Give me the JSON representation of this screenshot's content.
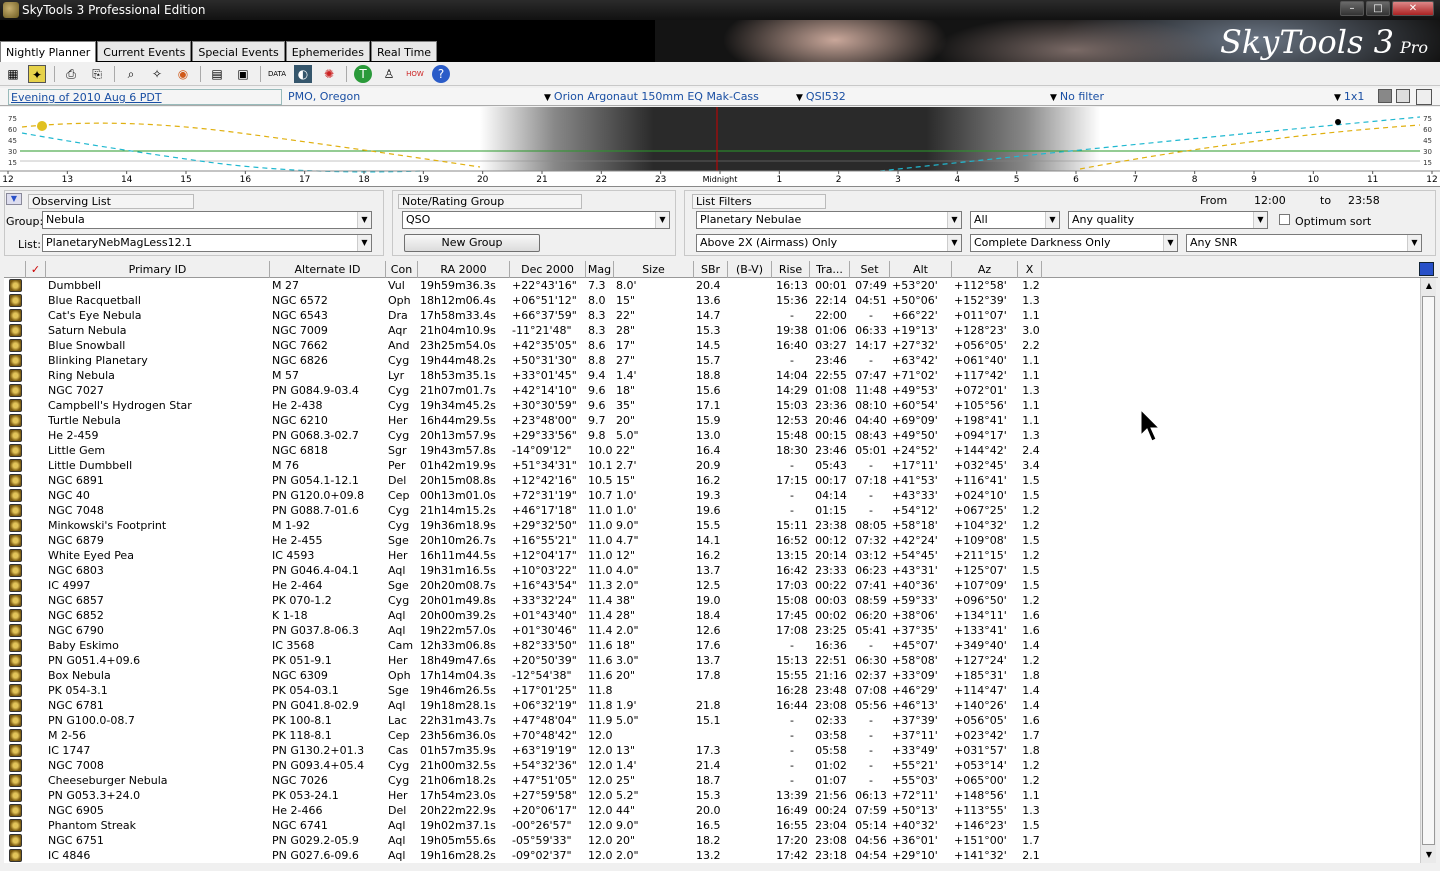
{
  "window": {
    "title": "SkyTools 3 Professional Edition",
    "minimize": "–",
    "maximize": "□",
    "close": "✕"
  },
  "banner": {
    "brand": "SkyTools 3",
    "edition": "Pro"
  },
  "tabs": [
    "Nightly Planner",
    "Current Events",
    "Special Events",
    "Ephemerides",
    "Real Time"
  ],
  "info": {
    "date": "Evening of 2010 Aug 6 PDT",
    "location": "PMO, Oregon",
    "telescope": "Orion Argonaut 150mm EQ Mak-Cass",
    "camera": "QSI532",
    "filter": "No filter",
    "layout": "1x1"
  },
  "graph": {
    "y_labels_left": [
      "75",
      "60",
      "45",
      "30",
      "15"
    ],
    "y_labels_right": [
      "75",
      "60",
      "45",
      "30",
      "15"
    ],
    "hours": [
      "12",
      "13",
      "14",
      "15",
      "16",
      "17",
      "18",
      "19",
      "20",
      "21",
      "22",
      "23",
      "Midnight",
      "1",
      "2",
      "3",
      "4",
      "5",
      "6",
      "7",
      "8",
      "9",
      "10",
      "11",
      "12"
    ]
  },
  "observing_list": {
    "title": "Observing List",
    "group_label": "Group:",
    "group_value": "Nebula",
    "list_label": "List:",
    "list_value": "PlanetaryNebMagLess12.1"
  },
  "note_group": {
    "title": "Note/Rating Group",
    "value": "QSO",
    "new_group": "New Group"
  },
  "list_filters": {
    "title": "List Filters",
    "from_label": "From",
    "from_value": "12:00",
    "to_label": "to",
    "to_value": "23:58",
    "type": "Planetary Nebulae",
    "constellation": "All",
    "quality": "Any quality",
    "optimum_sort": "Optimum sort",
    "airmass": "Above 2X (Airmass) Only",
    "darkness": "Complete Darkness Only",
    "snr": "Any SNR"
  },
  "columns": [
    "✓",
    "Primary ID",
    "Alternate ID",
    "Con",
    "RA 2000",
    "Dec 2000",
    "Mag",
    "Size",
    "SBr",
    "(B-V)",
    "Rise",
    "Tra...",
    "Set",
    "Alt",
    "Az",
    "X"
  ],
  "rows": [
    [
      "Dumbbell",
      "M 27",
      "Vul",
      "19h59m36.3s",
      "+22°43'16\"",
      "7.3",
      "8.0'",
      "20.4",
      "16:13",
      "00:01",
      "07:49",
      "+53°20'",
      "+112°58'",
      "1.2"
    ],
    [
      "Blue Racquetball",
      "NGC 6572",
      "Oph",
      "18h12m06.4s",
      "+06°51'12\"",
      "8.0",
      "15\"",
      "13.6",
      "15:36",
      "22:14",
      "04:51",
      "+50°06'",
      "+152°39'",
      "1.3"
    ],
    [
      "Cat's Eye Nebula",
      "NGC 6543",
      "Dra",
      "17h58m33.4s",
      "+66°37'59\"",
      "8.3",
      "22\"",
      "14.7",
      "-",
      "22:00",
      "-",
      "+66°22'",
      "+011°07'",
      "1.1"
    ],
    [
      "Saturn Nebula",
      "NGC 7009",
      "Aqr",
      "21h04m10.9s",
      "-11°21'48\"",
      "8.3",
      "28\"",
      "15.3",
      "19:38",
      "01:06",
      "06:33",
      "+19°13'",
      "+128°23'",
      "3.0"
    ],
    [
      "Blue Snowball",
      "NGC 7662",
      "And",
      "23h25m54.0s",
      "+42°35'05\"",
      "8.6",
      "17\"",
      "14.5",
      "16:40",
      "03:27",
      "14:17",
      "+27°32'",
      "+056°05'",
      "2.2"
    ],
    [
      "Blinking Planetary",
      "NGC 6826",
      "Cyg",
      "19h44m48.2s",
      "+50°31'30\"",
      "8.8",
      "27\"",
      "15.7",
      "-",
      "23:46",
      "-",
      "+63°42'",
      "+061°40'",
      "1.1"
    ],
    [
      "Ring Nebula",
      "M 57",
      "Lyr",
      "18h53m35.1s",
      "+33°01'45\"",
      "9.4",
      "1.4'",
      "18.8",
      "14:04",
      "22:55",
      "07:47",
      "+71°02'",
      "+117°42'",
      "1.1"
    ],
    [
      "NGC 7027",
      "PN G084.9-03.4",
      "Cyg",
      "21h07m01.7s",
      "+42°14'10\"",
      "9.6",
      "18\"",
      "15.6",
      "14:29",
      "01:08",
      "11:48",
      "+49°53'",
      "+072°01'",
      "1.3"
    ],
    [
      "Campbell's Hydrogen Star",
      "He 2-438",
      "Cyg",
      "19h34m45.2s",
      "+30°30'59\"",
      "9.6",
      "35\"",
      "17.1",
      "15:03",
      "23:36",
      "08:10",
      "+60°54'",
      "+105°56'",
      "1.1"
    ],
    [
      "Turtle Nebula",
      "NGC 6210",
      "Her",
      "16h44m29.5s",
      "+23°48'00\"",
      "9.7",
      "20\"",
      "15.9",
      "12:53",
      "20:46",
      "04:40",
      "+69°09'",
      "+198°41'",
      "1.1"
    ],
    [
      "He 2-459",
      "PN G068.3-02.7",
      "Cyg",
      "20h13m57.9s",
      "+29°33'56\"",
      "9.8",
      "5.0\"",
      "13.0",
      "15:48",
      "00:15",
      "08:43",
      "+49°50'",
      "+094°17'",
      "1.3"
    ],
    [
      "Little Gem",
      "NGC 6818",
      "Sgr",
      "19h43m57.8s",
      "-14°09'12\"",
      "10.0",
      "22\"",
      "16.4",
      "18:30",
      "23:46",
      "05:01",
      "+24°52'",
      "+144°42'",
      "2.4"
    ],
    [
      "Little Dumbbell",
      "M 76",
      "Per",
      "01h42m19.9s",
      "+51°34'31\"",
      "10.1",
      "2.7'",
      "20.9",
      "-",
      "05:43",
      "-",
      "+17°11'",
      "+032°45'",
      "3.4"
    ],
    [
      "NGC 6891",
      "PN G054.1-12.1",
      "Del",
      "20h15m08.8s",
      "+12°42'16\"",
      "10.5",
      "15\"",
      "16.2",
      "17:15",
      "00:17",
      "07:18",
      "+41°53'",
      "+116°41'",
      "1.5"
    ],
    [
      "NGC 40",
      "PN G120.0+09.8",
      "Cep",
      "00h13m01.0s",
      "+72°31'19\"",
      "10.7",
      "1.0'",
      "19.3",
      "-",
      "04:14",
      "-",
      "+43°33'",
      "+024°10'",
      "1.5"
    ],
    [
      "NGC 7048",
      "PN G088.7-01.6",
      "Cyg",
      "21h14m15.2s",
      "+46°17'18\"",
      "11.0",
      "1.0'",
      "19.6",
      "-",
      "01:15",
      "-",
      "+54°12'",
      "+067°25'",
      "1.2"
    ],
    [
      "Minkowski's Footprint",
      "M 1-92",
      "Cyg",
      "19h36m18.9s",
      "+29°32'50\"",
      "11.0",
      "9.0\"",
      "15.5",
      "15:11",
      "23:38",
      "08:05",
      "+58°18'",
      "+104°32'",
      "1.2"
    ],
    [
      "NGC 6879",
      "He 2-455",
      "Sge",
      "20h10m26.7s",
      "+16°55'21\"",
      "11.0",
      "4.7\"",
      "14.1",
      "16:52",
      "00:12",
      "07:32",
      "+42°24'",
      "+109°08'",
      "1.5"
    ],
    [
      "White Eyed Pea",
      "IC 4593",
      "Her",
      "16h11m44.5s",
      "+12°04'17\"",
      "11.0",
      "12\"",
      "16.2",
      "13:15",
      "20:14",
      "03:12",
      "+54°45'",
      "+211°15'",
      "1.2"
    ],
    [
      "NGC 6803",
      "PN G046.4-04.1",
      "Aql",
      "19h31m16.5s",
      "+10°03'22\"",
      "11.0",
      "4.0\"",
      "13.7",
      "16:42",
      "23:33",
      "06:23",
      "+43°31'",
      "+125°07'",
      "1.5"
    ],
    [
      "IC 4997",
      "He 2-464",
      "Sge",
      "20h20m08.7s",
      "+16°43'54\"",
      "11.3",
      "2.0\"",
      "12.5",
      "17:03",
      "00:22",
      "07:41",
      "+40°36'",
      "+107°09'",
      "1.5"
    ],
    [
      "NGC 6857",
      "PK 070-1.2",
      "Cyg",
      "20h01m49.8s",
      "+33°32'24\"",
      "11.4",
      "38\"",
      "19.0",
      "15:08",
      "00:03",
      "08:59",
      "+59°33'",
      "+096°50'",
      "1.2"
    ],
    [
      "NGC 6852",
      "K 1-18",
      "Aql",
      "20h00m39.2s",
      "+01°43'40\"",
      "11.4",
      "28\"",
      "18.4",
      "17:45",
      "00:02",
      "06:20",
      "+38°06'",
      "+134°11'",
      "1.6"
    ],
    [
      "NGC 6790",
      "PN G037.8-06.3",
      "Aql",
      "19h22m57.0s",
      "+01°30'46\"",
      "11.4",
      "2.0\"",
      "12.6",
      "17:08",
      "23:25",
      "05:41",
      "+37°35'",
      "+133°41'",
      "1.6"
    ],
    [
      "Baby Eskimo",
      "IC 3568",
      "Cam",
      "12h33m06.8s",
      "+82°33'50\"",
      "11.6",
      "18\"",
      "17.6",
      "-",
      "16:36",
      "-",
      "+45°07'",
      "+349°40'",
      "1.4"
    ],
    [
      "PN G051.4+09.6",
      "PK 051-9.1",
      "Her",
      "18h49m47.6s",
      "+20°50'39\"",
      "11.6",
      "3.0\"",
      "13.7",
      "15:13",
      "22:51",
      "06:30",
      "+58°08'",
      "+127°24'",
      "1.2"
    ],
    [
      "Box Nebula",
      "NGC 6309",
      "Oph",
      "17h14m04.3s",
      "-12°54'38\"",
      "11.6",
      "20\"",
      "17.8",
      "15:55",
      "21:16",
      "02:37",
      "+33°09'",
      "+185°31'",
      "1.8"
    ],
    [
      "PK 054-3.1",
      "PK 054-03.1",
      "Sge",
      "19h46m26.5s",
      "+17°01'25\"",
      "11.8",
      "",
      "",
      "16:28",
      "23:48",
      "07:08",
      "+46°29'",
      "+114°47'",
      "1.4"
    ],
    [
      "NGC 6781",
      "PN G041.8-02.9",
      "Aql",
      "19h18m28.1s",
      "+06°32'19\"",
      "11.8",
      "1.9'",
      "21.8",
      "16:44",
      "23:08",
      "05:56",
      "+46°13'",
      "+140°26'",
      "1.4"
    ],
    [
      "PN G100.0-08.7",
      "PK 100-8.1",
      "Lac",
      "22h31m43.7s",
      "+47°48'04\"",
      "11.9",
      "5.0\"",
      "15.1",
      "-",
      "02:33",
      "-",
      "+37°39'",
      "+056°05'",
      "1.6"
    ],
    [
      "M 2-56",
      "PK 118-8.1",
      "Cep",
      "23h56m36.0s",
      "+70°48'42\"",
      "12.0",
      "",
      "",
      "-",
      "03:58",
      "-",
      "+37°11'",
      "+023°42'",
      "1.7"
    ],
    [
      "IC 1747",
      "PN G130.2+01.3",
      "Cas",
      "01h57m35.9s",
      "+63°19'19\"",
      "12.0",
      "13\"",
      "17.3",
      "-",
      "05:58",
      "-",
      "+33°49'",
      "+031°57'",
      "1.8"
    ],
    [
      "NGC 7008",
      "PN G093.4+05.4",
      "Cyg",
      "21h00m32.5s",
      "+54°32'36\"",
      "12.0",
      "1.4'",
      "21.4",
      "-",
      "01:02",
      "-",
      "+55°21'",
      "+053°14'",
      "1.2"
    ],
    [
      "Cheeseburger Nebula",
      "NGC 7026",
      "Cyg",
      "21h06m18.2s",
      "+47°51'05\"",
      "12.0",
      "25\"",
      "18.7",
      "-",
      "01:07",
      "-",
      "+55°03'",
      "+065°00'",
      "1.2"
    ],
    [
      "PN G053.3+24.0",
      "PK 053-24.1",
      "Her",
      "17h54m23.0s",
      "+27°59'58\"",
      "12.0",
      "5.2\"",
      "15.3",
      "13:39",
      "21:56",
      "06:13",
      "+72°11'",
      "+148°56'",
      "1.1"
    ],
    [
      "NGC 6905",
      "He 2-466",
      "Del",
      "20h22m22.9s",
      "+20°06'17\"",
      "12.0",
      "44\"",
      "20.0",
      "16:49",
      "00:24",
      "07:59",
      "+50°13'",
      "+113°55'",
      "1.3"
    ],
    [
      "Phantom Streak",
      "NGC 6741",
      "Aql",
      "19h02m37.1s",
      "-00°26'57\"",
      "12.0",
      "9.0\"",
      "16.5",
      "16:55",
      "23:04",
      "05:14",
      "+40°32'",
      "+146°23'",
      "1.5"
    ],
    [
      "NGC 6751",
      "PN G029.2-05.9",
      "Aql",
      "19h05m55.6s",
      "-05°59'33\"",
      "12.0",
      "20\"",
      "18.2",
      "17:20",
      "23:08",
      "04:56",
      "+36°01'",
      "+151°00'",
      "1.7"
    ],
    [
      "IC 4846",
      "PN G027.6-09.6",
      "Aql",
      "19h16m28.2s",
      "-09°02'37\"",
      "12.0",
      "2.0\"",
      "13.2",
      "17:42",
      "23:18",
      "04:54",
      "+29°10'",
      "+141°32'",
      "2.1"
    ]
  ]
}
